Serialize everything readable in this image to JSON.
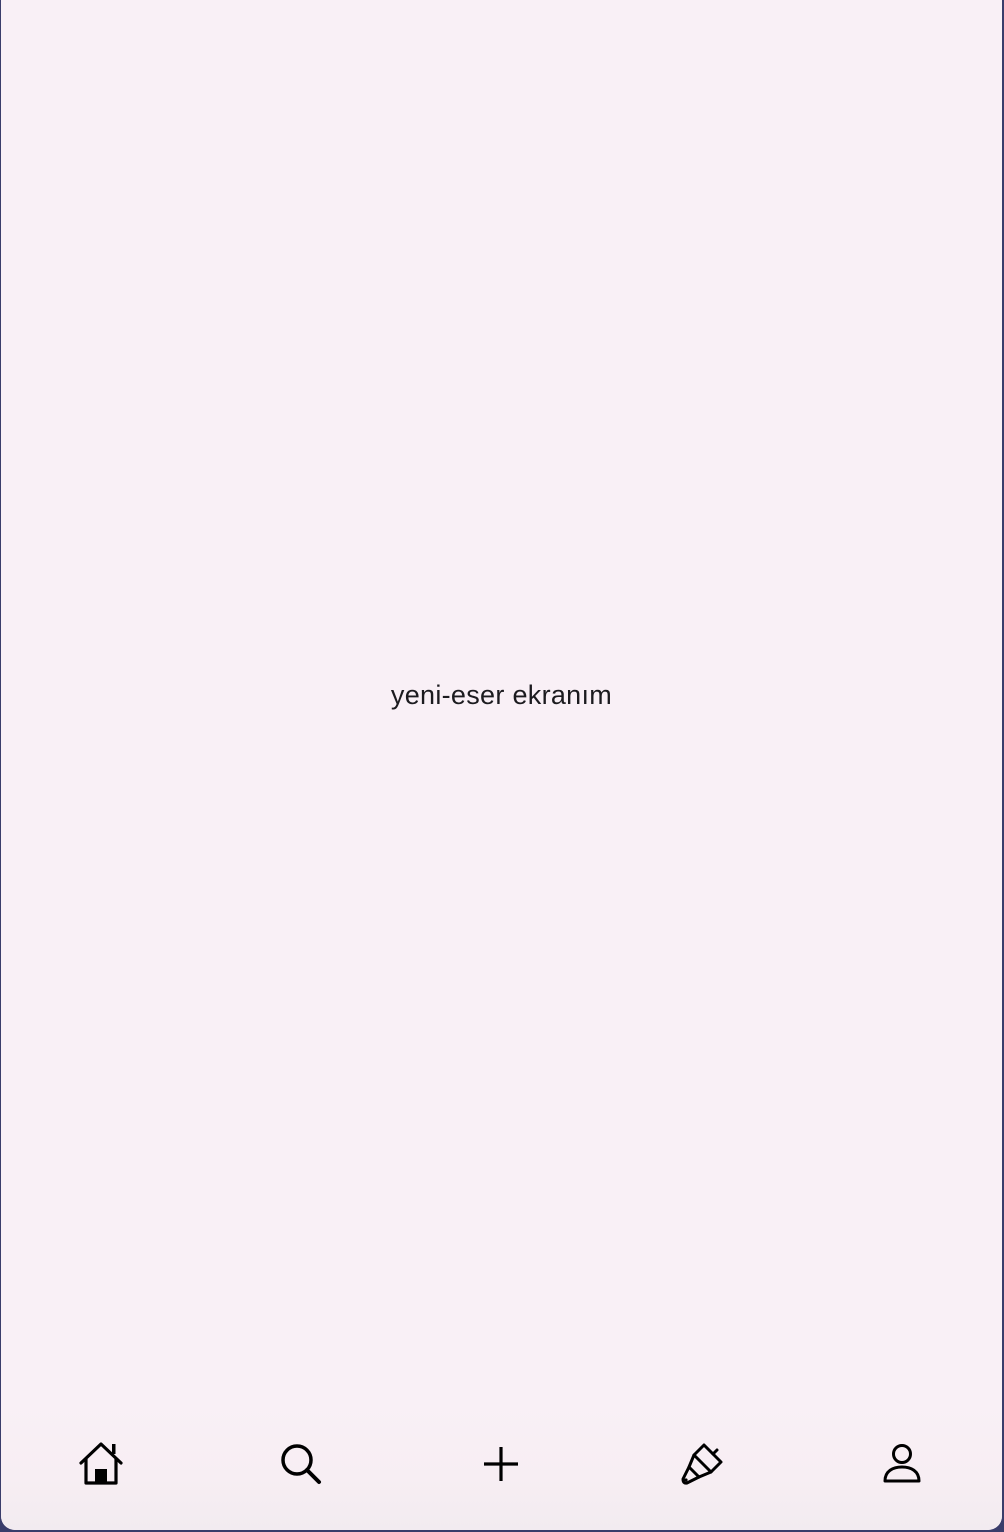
{
  "screen": {
    "text": "yeni-eser ekranım"
  },
  "bottom_nav": {
    "items": [
      {
        "icon": "home-icon"
      },
      {
        "icon": "search-icon"
      },
      {
        "icon": "plus-icon"
      },
      {
        "icon": "paintbrush-icon"
      },
      {
        "icon": "user-icon"
      }
    ]
  },
  "colors": {
    "background": "#f9f0f6",
    "text": "#1c1b1f",
    "icon": "#000000"
  }
}
